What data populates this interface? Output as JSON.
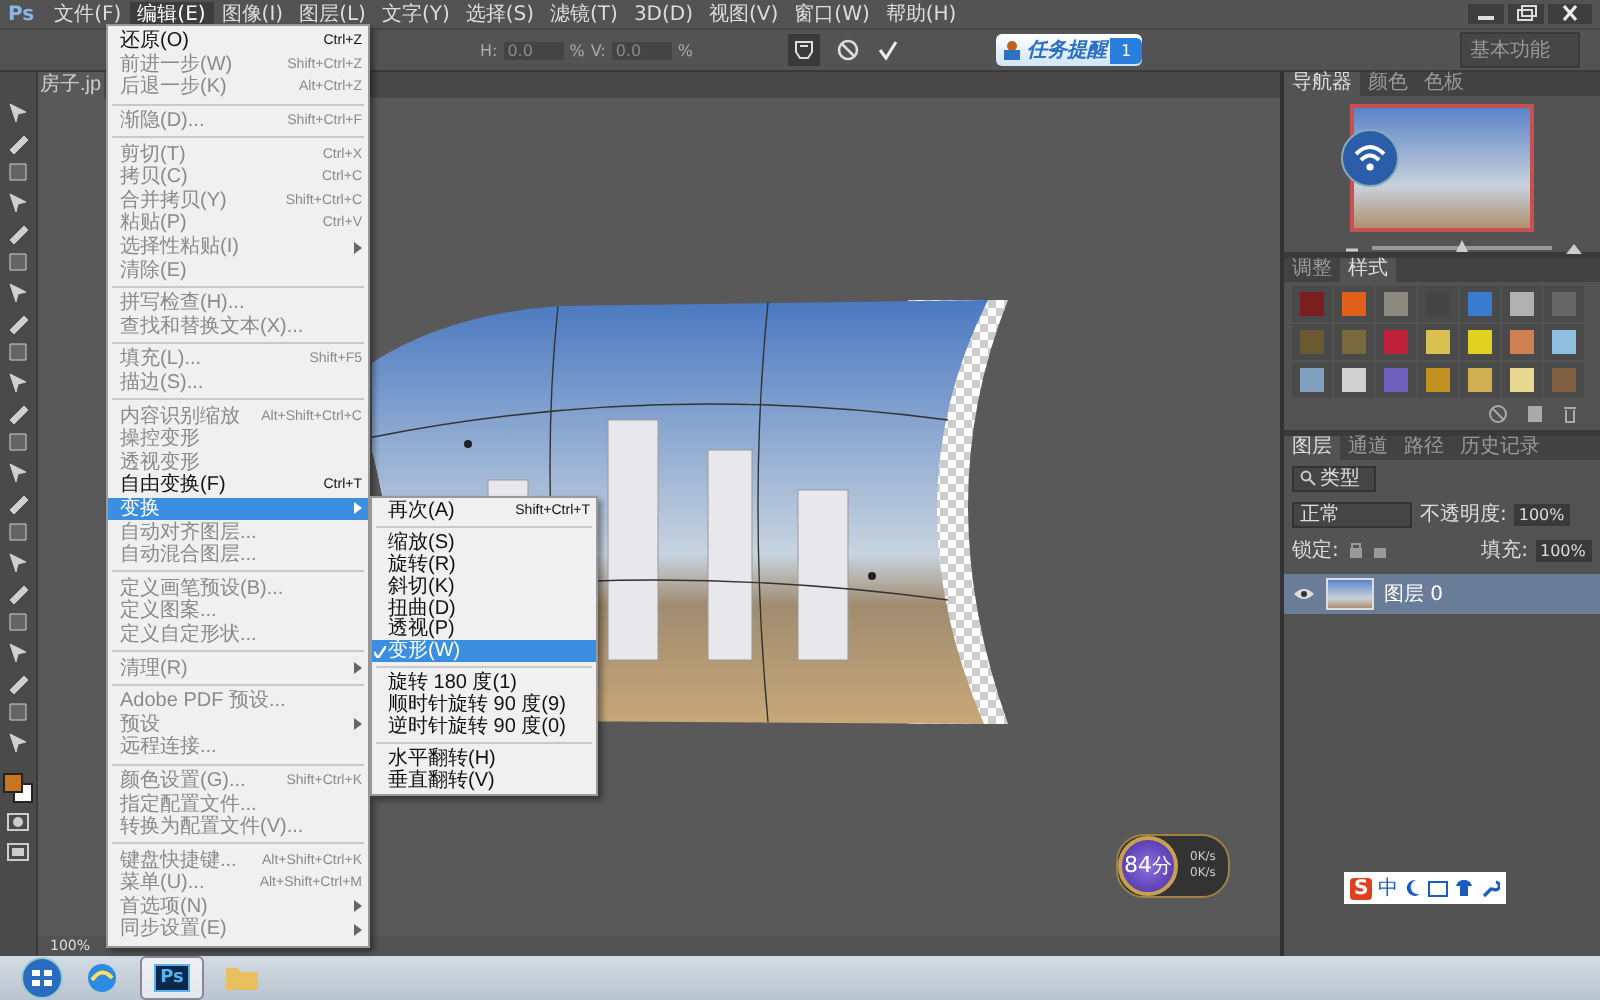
{
  "app": {
    "logo": "Ps"
  },
  "menubar": {
    "items": [
      {
        "label": "文件(F)",
        "selected": false
      },
      {
        "label": "编辑(E)",
        "selected": true
      },
      {
        "label": "图像(I)",
        "selected": false
      },
      {
        "label": "图层(L)",
        "selected": false
      },
      {
        "label": "文字(Y)",
        "selected": false
      },
      {
        "label": "选择(S)",
        "selected": false
      },
      {
        "label": "滤镜(T)",
        "selected": false
      },
      {
        "label": "3D(D)",
        "selected": false
      },
      {
        "label": "视图(V)",
        "selected": false
      },
      {
        "label": "窗口(W)",
        "selected": false
      },
      {
        "label": "帮助(H)",
        "selected": false
      }
    ]
  },
  "options_bar": {
    "fields": [
      {
        "label": "H:",
        "value": "0.0",
        "unit": "%"
      },
      {
        "label": "V:",
        "value": "0.0",
        "unit": "%"
      }
    ]
  },
  "task_reminder": {
    "label": "任务提醒",
    "count": "1"
  },
  "workspace_switcher": {
    "value": "基本功能"
  },
  "document_tab": {
    "title": "房子.jp"
  },
  "edit_menu": {
    "groups": [
      {
        "items": [
          {
            "label": "还原(O)",
            "shortcut": "Ctrl+Z",
            "submenu": false,
            "disabled": false,
            "selected": false
          },
          {
            "label": "前进一步(W)",
            "shortcut": "Shift+Ctrl+Z",
            "submenu": false,
            "disabled": true,
            "selected": false
          },
          {
            "label": "后退一步(K)",
            "shortcut": "Alt+Ctrl+Z",
            "submenu": false,
            "disabled": true,
            "selected": false
          }
        ]
      },
      {
        "items": [
          {
            "label": "渐隐(D)...",
            "shortcut": "Shift+Ctrl+F",
            "submenu": false,
            "disabled": true,
            "selected": false
          }
        ]
      },
      {
        "items": [
          {
            "label": "剪切(T)",
            "shortcut": "Ctrl+X",
            "submenu": false,
            "disabled": true,
            "selected": false
          },
          {
            "label": "拷贝(C)",
            "shortcut": "Ctrl+C",
            "submenu": false,
            "disabled": true,
            "selected": false
          },
          {
            "label": "合并拷贝(Y)",
            "shortcut": "Shift+Ctrl+C",
            "submenu": false,
            "disabled": true,
            "selected": false
          },
          {
            "label": "粘贴(P)",
            "shortcut": "Ctrl+V",
            "submenu": false,
            "disabled": true,
            "selected": false
          },
          {
            "label": "选择性粘贴(I)",
            "submenu": true,
            "disabled": true,
            "selected": false
          },
          {
            "label": "清除(E)",
            "submenu": false,
            "disabled": true,
            "selected": false
          }
        ]
      },
      {
        "items": [
          {
            "label": "拼写检查(H)...",
            "submenu": false,
            "disabled": true,
            "selected": false
          },
          {
            "label": "查找和替换文本(X)...",
            "submenu": false,
            "disabled": true,
            "selected": false
          }
        ]
      },
      {
        "items": [
          {
            "label": "填充(L)...",
            "shortcut": "Shift+F5",
            "submenu": false,
            "disabled": true,
            "selected": false
          },
          {
            "label": "描边(S)...",
            "submenu": false,
            "disabled": true,
            "selected": false
          }
        ]
      },
      {
        "items": [
          {
            "label": "内容识别缩放",
            "shortcut": "Alt+Shift+Ctrl+C",
            "submenu": false,
            "disabled": true,
            "selected": false
          },
          {
            "label": "操控变形",
            "submenu": false,
            "disabled": true,
            "selected": false
          },
          {
            "label": "透视变形",
            "submenu": false,
            "disabled": true,
            "selected": false
          },
          {
            "label": "自由变换(F)",
            "shortcut": "Ctrl+T",
            "submenu": false,
            "disabled": false,
            "selected": false
          },
          {
            "label": "变换",
            "submenu": true,
            "disabled": false,
            "selected": true
          },
          {
            "label": "自动对齐图层...",
            "submenu": false,
            "disabled": true,
            "selected": false
          },
          {
            "label": "自动混合图层...",
            "submenu": false,
            "disabled": true,
            "selected": false
          }
        ]
      },
      {
        "items": [
          {
            "label": "定义画笔预设(B)...",
            "submenu": false,
            "disabled": true,
            "selected": false
          },
          {
            "label": "定义图案...",
            "submenu": false,
            "disabled": true,
            "selected": false
          },
          {
            "label": "定义自定形状...",
            "submenu": false,
            "disabled": true,
            "selected": false
          }
        ]
      },
      {
        "items": [
          {
            "label": "清理(R)",
            "submenu": true,
            "disabled": true,
            "selected": false
          }
        ]
      },
      {
        "items": [
          {
            "label": "Adobe PDF 预设...",
            "submenu": false,
            "disabled": true,
            "selected": false
          },
          {
            "label": "预设",
            "submenu": true,
            "disabled": true,
            "selected": false
          },
          {
            "label": "远程连接...",
            "submenu": false,
            "disabled": true,
            "selected": false
          }
        ]
      },
      {
        "items": [
          {
            "label": "颜色设置(G)...",
            "shortcut": "Shift+Ctrl+K",
            "submenu": false,
            "disabled": true,
            "selected": false
          },
          {
            "label": "指定配置文件...",
            "submenu": false,
            "disabled": true,
            "selected": false
          },
          {
            "label": "转换为配置文件(V)...",
            "submenu": false,
            "disabled": true,
            "selected": false
          }
        ]
      },
      {
        "items": [
          {
            "label": "键盘快捷键...",
            "shortcut": "Alt+Shift+Ctrl+K",
            "submenu": false,
            "disabled": true,
            "selected": false
          },
          {
            "label": "菜单(U)...",
            "shortcut": "Alt+Shift+Ctrl+M",
            "submenu": false,
            "disabled": true,
            "selected": false
          },
          {
            "label": "首选项(N)",
            "submenu": true,
            "disabled": true,
            "selected": false
          },
          {
            "label": "同步设置(E)",
            "submenu": true,
            "disabled": true,
            "selected": false
          }
        ]
      }
    ]
  },
  "transform_submenu": {
    "groups": [
      {
        "items": [
          {
            "label": "再次(A)",
            "shortcut": "Shift+Ctrl+T",
            "checked": false,
            "selected": false
          }
        ]
      },
      {
        "items": [
          {
            "label": "缩放(S)",
            "checked": false,
            "selected": false
          },
          {
            "label": "旋转(R)",
            "checked": false,
            "selected": false
          },
          {
            "label": "斜切(K)",
            "checked": false,
            "selected": false
          },
          {
            "label": "扭曲(D)",
            "checked": false,
            "selected": false
          },
          {
            "label": "透视(P)",
            "checked": false,
            "selected": false
          },
          {
            "label": "变形(W)",
            "checked": true,
            "selected": true
          }
        ]
      },
      {
        "items": [
          {
            "label": "旋转 180 度(1)",
            "checked": false,
            "selected": false
          },
          {
            "label": "顺时针旋转 90 度(9)",
            "checked": false,
            "selected": false
          },
          {
            "label": "逆时针旋转 90 度(0)",
            "checked": false,
            "selected": false
          }
        ]
      },
      {
        "items": [
          {
            "label": "水平翻转(H)",
            "checked": false,
            "selected": false
          },
          {
            "label": "垂直翻转(V)",
            "checked": false,
            "selected": false
          }
        ]
      }
    ]
  },
  "navigator_panel": {
    "tabs": [
      {
        "label": "导航器",
        "selected": true
      },
      {
        "label": "颜色",
        "selected": false
      },
      {
        "label": "色板",
        "selected": false
      }
    ],
    "zoom": {
      "level": 0.5
    }
  },
  "styles_panel": {
    "tabs": [
      {
        "label": "调整",
        "selected": false
      },
      {
        "label": "样式",
        "selected": true
      }
    ]
  },
  "layers_panel": {
    "tabs": [
      {
        "label": "图层",
        "selected": true
      },
      {
        "label": "通道",
        "selected": false
      },
      {
        "label": "路径",
        "selected": false
      },
      {
        "label": "历史记录",
        "selected": false
      }
    ],
    "filter": "类型",
    "blend_mode": "正常",
    "opacity_label": "不透明度:",
    "opacity": "100%",
    "lock_label": "锁定:",
    "fill_label": "填充:",
    "fill": "100%",
    "layers": [
      {
        "name": "图层 0",
        "visible": true,
        "selected": true
      }
    ]
  },
  "speed_widget": {
    "score": "84",
    "unit": "分",
    "upload": "0K/s",
    "download": "0K/s"
  },
  "ime_bar": {
    "logo": "S",
    "mode": "中"
  },
  "status_bar": {
    "zoom": "100%"
  },
  "taskbar": {
    "apps": [
      {
        "kind": "browser",
        "selected": false
      },
      {
        "kind": "photoshop",
        "label": "Ps",
        "selected": true
      },
      {
        "kind": "folder",
        "selected": false
      }
    ]
  }
}
